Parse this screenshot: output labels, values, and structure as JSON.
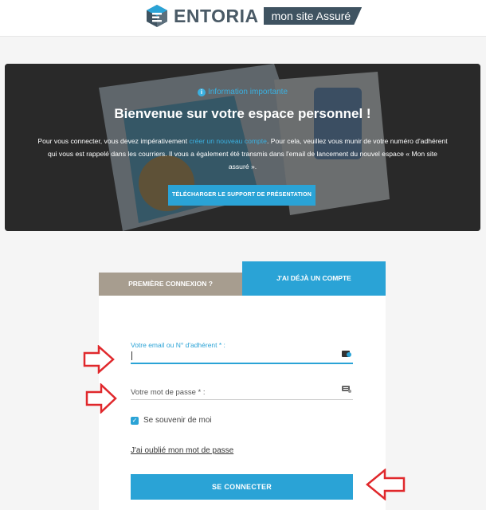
{
  "brand": {
    "name": "ENTORIA",
    "tagline": "mon site Assuré"
  },
  "banner": {
    "info": "Information importante",
    "title": "Bienvenue sur votre espace personnel !",
    "text_before_link": "Pour vous connecter, vous devez impérativement ",
    "link": "créer un nouveau compte",
    "text_after_link": ". Pour cela, veuillez vous munir de votre numéro d'adhérent qui vous est rappelé dans les courriers. Il vous a également été transmis dans l'email de lancement du nouvel espace « Mon site assuré ».",
    "download_button": "TÉLÉCHARGER LE SUPPORT DE PRÉSENTATION"
  },
  "tabs": {
    "first": "PREMIÈRE CONNEXION ?",
    "account": "J'AI DÉJÀ UN COMPTE"
  },
  "form": {
    "email_label": "Votre email ou N° d'adhérent * :",
    "password_label": "Votre mot de passe * :",
    "remember": "Se souvenir de moi",
    "forgot": "J'ai oublié mon mot de passe",
    "submit": "SE CONNECTER"
  },
  "colors": {
    "accent": "#2aa3d6",
    "tab_inactive": "#a79d8f",
    "annotation": "#e0282c"
  }
}
